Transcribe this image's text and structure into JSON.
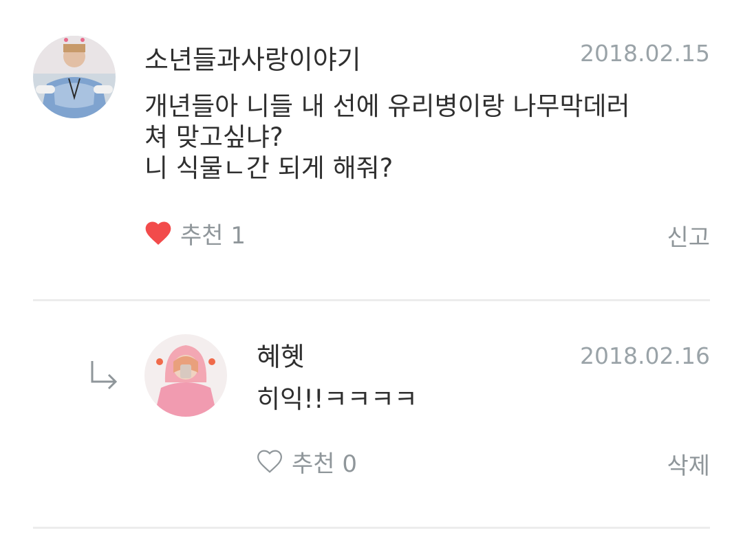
{
  "comments": [
    {
      "username": "소년들과사랑이야기",
      "date": "2018.02.15",
      "body": "개년들아 니들 내 선에 유리병이랑 나무막데러\n쳐 맞고싶냐?\n니 식물ㄴ간 되게 해줘?",
      "like_label": "추천 1",
      "liked": true,
      "side_action": "신고",
      "avatar_icon": "profile-photo",
      "like_icon": "heart-filled-icon",
      "like_color": "#f24b4b"
    },
    {
      "username": "혜혯",
      "date": "2018.02.16",
      "body": "히익!!ㅋㅋㅋㅋ",
      "like_label": "추천 0",
      "liked": false,
      "side_action": "삭제",
      "avatar_icon": "profile-photo",
      "like_icon": "heart-outline-icon",
      "reply_icon": "reply-arrow-icon"
    }
  ],
  "colors": {
    "text": "#2f2f2f",
    "muted": "#8f969a",
    "date": "#9aa3a8",
    "divider": "#ececec",
    "heart": "#f24b4b"
  }
}
